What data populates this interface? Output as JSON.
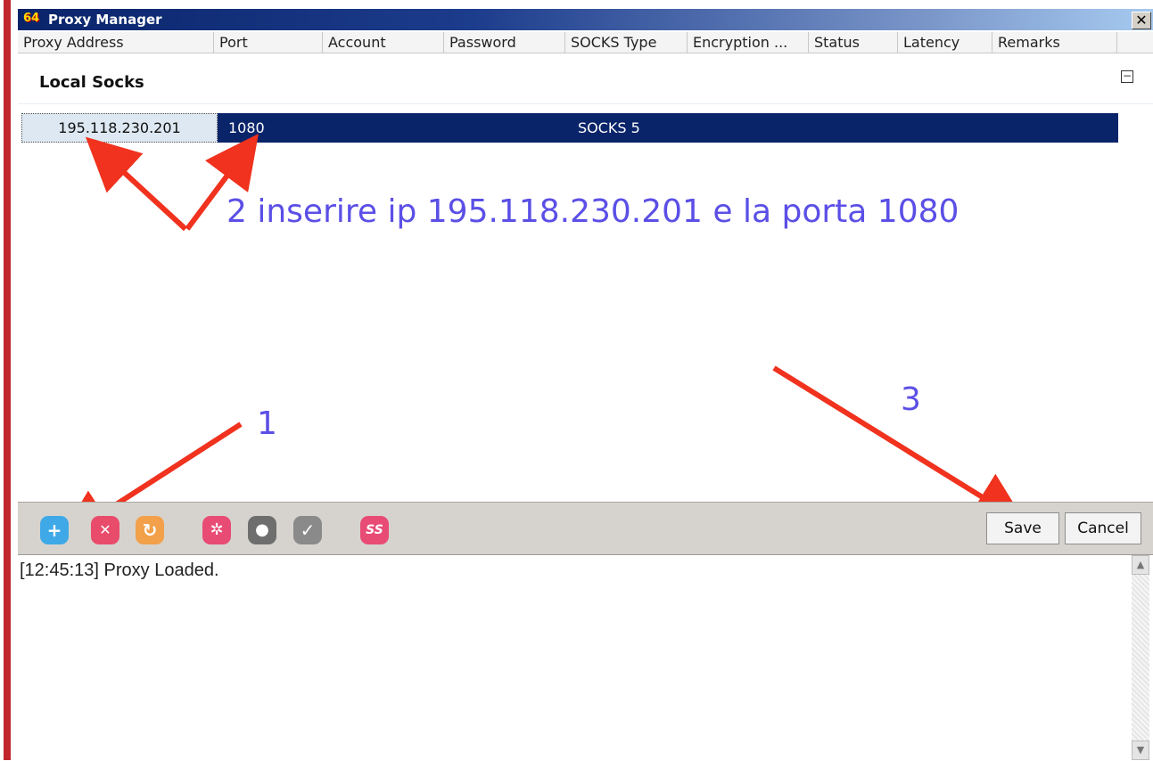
{
  "window": {
    "title": "Proxy Manager",
    "app_icon_label": "64",
    "close_glyph": "✕"
  },
  "columns": [
    {
      "label": "Proxy Address"
    },
    {
      "label": "Port"
    },
    {
      "label": "Account"
    },
    {
      "label": "Password"
    },
    {
      "label": "SOCKS Type"
    },
    {
      "label": "Encryption ..."
    },
    {
      "label": "Status"
    },
    {
      "label": "Latency"
    },
    {
      "label": "Remarks"
    }
  ],
  "group": {
    "label": "Local Socks",
    "collapse_glyph": "−"
  },
  "rows": [
    {
      "address": "195.118.230.201",
      "port": "1080",
      "socks_type": "SOCKS 5"
    }
  ],
  "annotations": {
    "step1": "1",
    "step2": "2 inserire ip 195.118.230.201 e la porta 1080",
    "step3": "3",
    "arrow_color": "#f0321e",
    "text_color": "#5b4fe6"
  },
  "toolbar": {
    "icons": [
      {
        "name": "add-icon",
        "glyph": "+",
        "color": "#3fa9e8"
      },
      {
        "name": "remove-icon",
        "glyph": "✕",
        "color": "#e94b6b"
      },
      {
        "name": "refresh-icon",
        "glyph": "↻",
        "color": "#f2a04a"
      },
      {
        "name": "settings-icon",
        "glyph": "✲",
        "color": "#e84b74"
      },
      {
        "name": "bulb-icon",
        "glyph": "●",
        "color": "#6e6e6e"
      },
      {
        "name": "check-icon",
        "glyph": "✓",
        "color": "#8a8a8a"
      },
      {
        "name": "ss-icon",
        "glyph": "SS",
        "color": "#e84b74"
      }
    ],
    "save_label": "Save",
    "cancel_label": "Cancel"
  },
  "log": {
    "line": "[12:45:13]  Proxy Loaded."
  },
  "scroll": {
    "up_glyph": "▲",
    "down_glyph": "▼"
  }
}
